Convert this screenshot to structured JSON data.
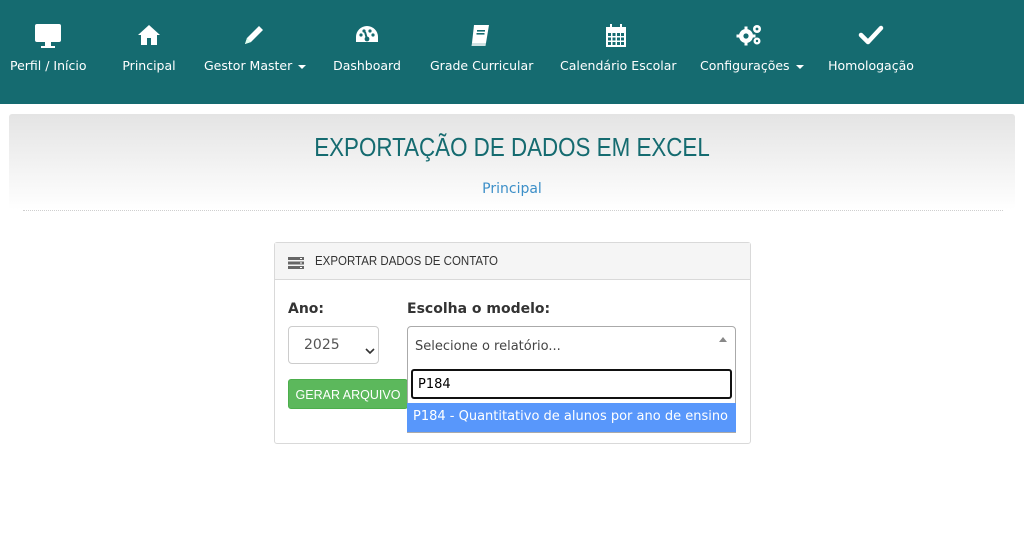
{
  "nav": {
    "items": [
      {
        "label": "Perfil / Início",
        "icon": "monitor-icon"
      },
      {
        "label": "Principal",
        "icon": "home-icon"
      },
      {
        "label": "Gestor Master",
        "icon": "pencil-icon",
        "has_dropdown": true
      },
      {
        "label": "Dashboard",
        "icon": "dashboard-gauge-icon"
      },
      {
        "label": "Grade Curricular",
        "icon": "book-icon"
      },
      {
        "label": "Calendário Escolar",
        "icon": "calendar-icon"
      },
      {
        "label": "Configurações",
        "icon": "gears-icon",
        "has_dropdown": true
      },
      {
        "label": "Homologação",
        "icon": "check-icon"
      }
    ]
  },
  "page": {
    "title": "EXPORTAÇÃO DE DADOS EM EXCEL",
    "breadcrumb": "Principal"
  },
  "panel": {
    "title": "EXPORTAR DADOS DE CONTATO",
    "year_label": "Ano:",
    "year_value": "2025",
    "model_label": "Escolha o modelo:",
    "model_placeholder": "Selecione o relatório...",
    "search_value": "P184",
    "option": "P184 - Quantitativo de alunos por ano de ensino",
    "generate_button": "GERAR ARQUIVO"
  },
  "colors": {
    "topbar": "#156b70",
    "title": "#156b70",
    "link": "#3c8fc8",
    "button_green": "#5cb85c",
    "option_highlight": "#5897fb"
  }
}
